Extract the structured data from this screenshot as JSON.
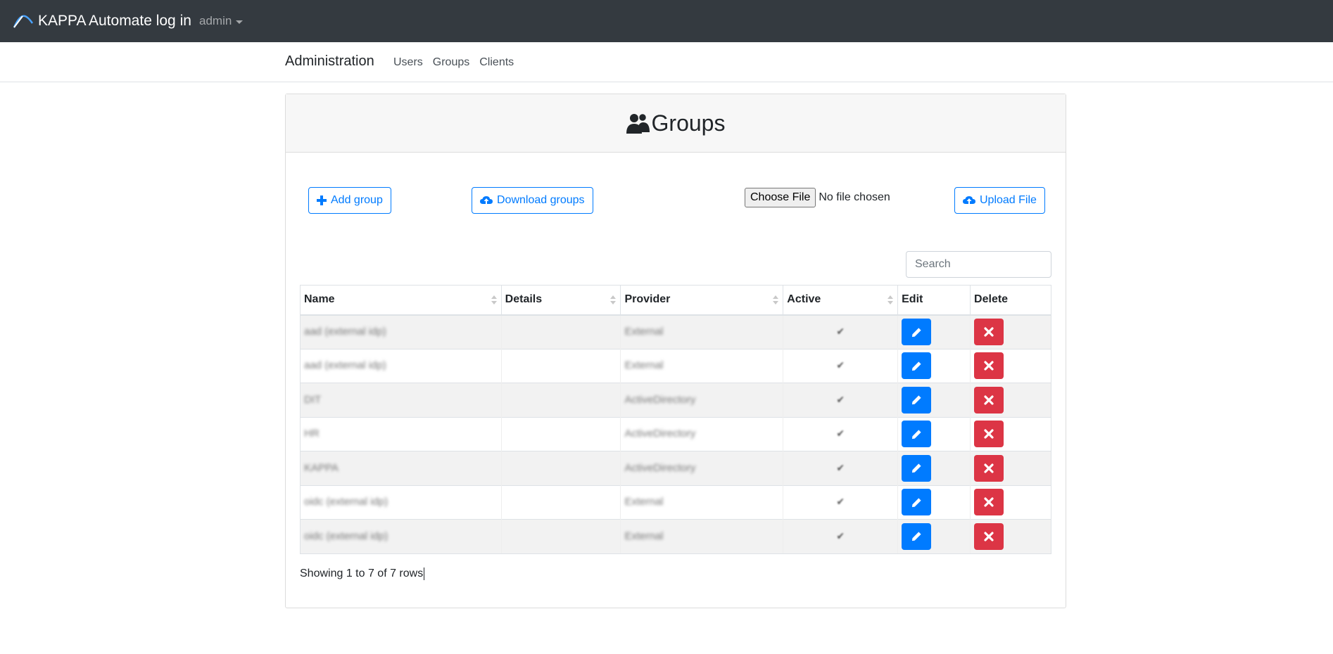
{
  "navbar": {
    "brand": "KAPPA Automate log in",
    "user": "admin"
  },
  "subnav": {
    "title": "Administration",
    "links": [
      "Users",
      "Groups",
      "Clients"
    ]
  },
  "card": {
    "title": "Groups",
    "buttons": {
      "add": "Add group",
      "download": "Download groups",
      "choose_file": "Choose File",
      "no_file": "No file chosen",
      "upload": "Upload File"
    },
    "search_placeholder": "Search",
    "columns": [
      "Name",
      "Details",
      "Provider",
      "Active",
      "Edit",
      "Delete"
    ],
    "rows": [
      {
        "name": "aad (external idp)",
        "details": "",
        "provider": "External",
        "active": "✔"
      },
      {
        "name": "aad (external idp)",
        "details": "",
        "provider": "External",
        "active": "✔"
      },
      {
        "name": "DIT",
        "details": "",
        "provider": "ActiveDirectory",
        "active": "✔"
      },
      {
        "name": "HR",
        "details": "",
        "provider": "ActiveDirectory",
        "active": "✔"
      },
      {
        "name": "KAPPA",
        "details": "",
        "provider": "ActiveDirectory",
        "active": "✔"
      },
      {
        "name": "oidc (external idp)",
        "details": "",
        "provider": "External",
        "active": "✔"
      },
      {
        "name": "oidc (external idp)",
        "details": "",
        "provider": "External",
        "active": "✔"
      }
    ],
    "footer": "Showing 1 to 7 of 7 rows"
  },
  "colors": {
    "navbar_bg": "#343a40",
    "primary": "#007bff",
    "danger": "#dc3545"
  }
}
